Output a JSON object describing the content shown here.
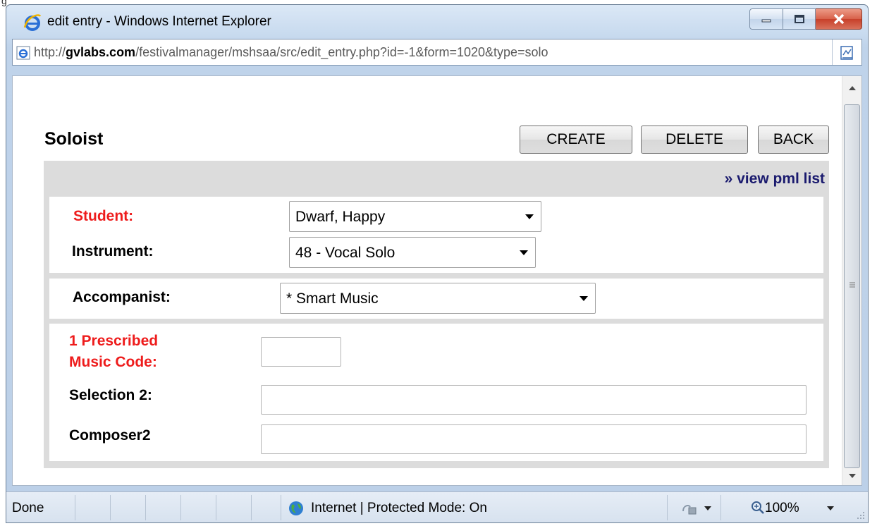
{
  "corner_fragment": "g",
  "window": {
    "title": "edit entry - Windows Internet Explorer",
    "url_prefix": "http://",
    "url_domain": "gvlabs.com",
    "url_path": "/festivalmanager/mshsaa/src/edit_entry.php?id=-1&form=1020&type=solo"
  },
  "page": {
    "title": "Soloist",
    "buttons": {
      "create": "CREATE",
      "delete": "DELETE",
      "back": "BACK"
    },
    "view_link": "» view pml list"
  },
  "form": {
    "student_label": "Student:",
    "student_value": "Dwarf, Happy",
    "instrument_label": "Instrument:",
    "instrument_value": "48 - Vocal Solo",
    "accompanist_label": "Accompanist:",
    "accompanist_value": "* Smart Music",
    "pml_label_line1": "1 Prescribed",
    "pml_label_line2": "Music Code:",
    "pml_value": "",
    "selection2_label": "Selection 2:",
    "selection2_value": "",
    "composer2_label": "Composer2",
    "composer2_value": ""
  },
  "statusbar": {
    "status": "Done",
    "zone": "Internet | Protected Mode: On",
    "zoom": "100%"
  },
  "colors": {
    "required_label": "#ee1c1c",
    "link": "#1a1a6e",
    "panel_bg": "#dcdcdc"
  },
  "icons": [
    "ie-logo-icon",
    "minimize-icon",
    "maximize-icon",
    "close-icon",
    "page-icon",
    "compatibility-view-icon",
    "scroll-up-icon",
    "scroll-down-icon",
    "globe-icon",
    "protected-mode-icon",
    "zoom-icon",
    "resize-grip-icon"
  ]
}
